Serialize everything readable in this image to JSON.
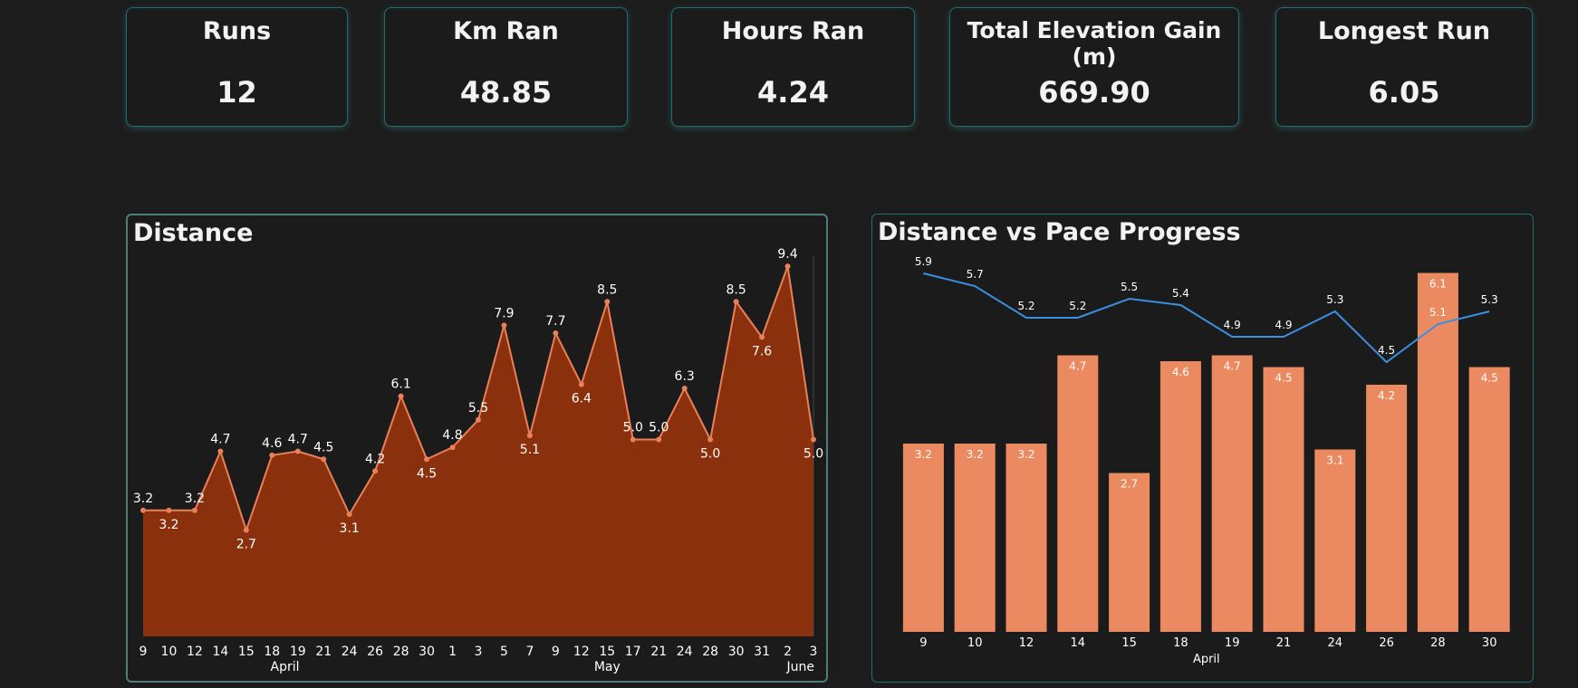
{
  "kpis": [
    {
      "title": "Runs",
      "value": "12"
    },
    {
      "title": "Km Ran",
      "value": "48.85"
    },
    {
      "title": "Hours Ran",
      "value": "4.24"
    },
    {
      "title": "Total Elevation Gain (m)",
      "value": "669.90"
    },
    {
      "title": "Longest Run",
      "value": "6.05"
    }
  ],
  "colors": {
    "background": "#1c1c1c",
    "card_border": "#1f6f72",
    "area_fill": "#8b300d",
    "area_line": "#e9805a",
    "bar_fill": "#eb8a60",
    "pace_line": "#3b8fe0",
    "text": "#ffffff"
  },
  "chart_data": [
    {
      "type": "area",
      "title": "Distance",
      "x": [
        "9",
        "10",
        "12",
        "14",
        "15",
        "18",
        "19",
        "21",
        "24",
        "26",
        "28",
        "30",
        "1",
        "3",
        "5",
        "7",
        "9",
        "12",
        "15",
        "17",
        "21",
        "24",
        "28",
        "30",
        "31",
        "2",
        "3"
      ],
      "values": [
        3.2,
        3.2,
        3.2,
        4.7,
        2.7,
        4.6,
        4.7,
        4.5,
        3.1,
        4.2,
        6.1,
        4.5,
        4.8,
        5.5,
        7.9,
        5.1,
        7.7,
        6.4,
        8.5,
        5.0,
        5.0,
        6.3,
        5.0,
        8.5,
        7.6,
        9.4,
        5.0
      ],
      "labels": [
        "3.2",
        "3.2",
        "3.2",
        "4.7",
        "2.7",
        "4.6",
        "4.7",
        "4.5",
        "3.1",
        "4.2",
        "6.1",
        "4.5",
        "4.8",
        "5.5",
        "7.9",
        "5.1",
        "7.7",
        "6.4",
        "8.5",
        "5.0",
        "5.0",
        "6.3",
        "5.0",
        "8.5",
        "7.6",
        "9.4",
        "5.0"
      ],
      "months": [
        {
          "label": "April",
          "start": 0,
          "end": 11
        },
        {
          "label": "May",
          "start": 12,
          "end": 24
        },
        {
          "label": "June",
          "start": 25,
          "end": 26
        }
      ],
      "ylim": [
        0,
        10
      ]
    },
    {
      "type": "bar",
      "title": "Distance vs Pace Progress",
      "categories": [
        "9",
        "10",
        "12",
        "14",
        "15",
        "18",
        "19",
        "21",
        "24",
        "26",
        "28",
        "30"
      ],
      "xlabel": "April",
      "series": [
        {
          "type": "bar",
          "values": [
            3.2,
            3.2,
            3.2,
            4.7,
            2.7,
            4.6,
            4.7,
            4.5,
            3.1,
            4.2,
            6.1,
            4.5
          ],
          "labels": [
            "3.2",
            "3.2",
            "3.2",
            "4.7",
            "2.7",
            "4.6",
            "4.7",
            "4.5",
            "3.1",
            "4.2",
            "6.1",
            "4.5"
          ]
        },
        {
          "type": "line",
          "values": [
            5.9,
            5.7,
            5.2,
            5.2,
            5.5,
            5.4,
            4.9,
            4.9,
            5.3,
            4.5,
            5.1,
            5.3
          ],
          "labels": [
            "5.9",
            "5.7",
            "5.2",
            "5.2",
            "5.5",
            "5.4",
            "4.9",
            "4.9",
            "5.3",
            "4.5",
            "5.1",
            "5.3"
          ]
        }
      ]
    }
  ]
}
